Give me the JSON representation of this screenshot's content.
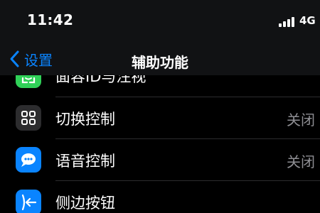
{
  "status": {
    "time": "11:42",
    "carrier": "4G"
  },
  "nav": {
    "back_label": "设置",
    "title": "辅助功能"
  },
  "rows": [
    {
      "label": "面容ID与注视",
      "value": "",
      "icon": "face-id-icon",
      "color": "#30d158"
    },
    {
      "label": "切换控制",
      "value": "关闭",
      "icon": "switch-control-icon",
      "color": "#2c2c2e"
    },
    {
      "label": "语音控制",
      "value": "关闭",
      "icon": "voice-control-icon",
      "color": "#0a84ff"
    },
    {
      "label": "侧边按钮",
      "value": "",
      "icon": "side-button-icon",
      "color": "#0a84ff"
    }
  ]
}
